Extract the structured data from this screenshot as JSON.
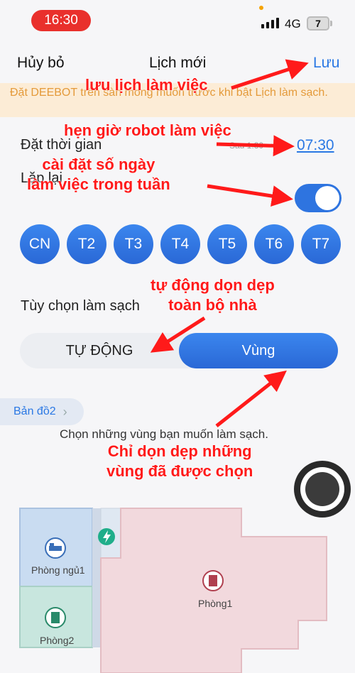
{
  "status_bar": {
    "time": "16:30",
    "network": "4G",
    "battery": "7"
  },
  "header": {
    "cancel": "Hủy bỏ",
    "title": "Lịch mới",
    "save": "Lưu"
  },
  "warning": "Đặt DEEBOT trên sàn mong muốn trước khi bật Lịch làm sạch.",
  "schedule": {
    "set_time_label": "Đặt thời gian",
    "time_secondary": "Sau 1:30",
    "time_value": "07:30",
    "repeat_label": "Lặp lại",
    "repeat_enabled": true
  },
  "days": [
    "CN",
    "T2",
    "T3",
    "T4",
    "T5",
    "T6",
    "T7"
  ],
  "cleaning": {
    "options_label": "Tùy chọn làm sạch",
    "mode_auto": "TỰ ĐỘNG",
    "mode_zone": "Vùng",
    "selected_mode": "Vùng"
  },
  "map": {
    "tab_label": "Bản đồ2",
    "instruction": "Chọn những vùng bạn muốn làm sạch.",
    "rooms": [
      "Phòng ngủ1",
      "Phòng1",
      "Phòng2"
    ]
  },
  "annotations": {
    "save_note": "lưu lịch làm việc",
    "time_note": "hẹn giờ robot làm việc",
    "days_note": "cài đặt số ngày\nlàm việc trong tuần",
    "auto_note": "tự động dọn dẹp\ntoàn bộ nhà",
    "zone_note": "Chỉ dọn dẹp những\nvùng đã được chọn"
  },
  "colors": {
    "accent": "#2a78e4",
    "status_red": "#e9302c",
    "warning_bg": "#fcecd6",
    "warning_text": "#e49a3a",
    "annotation_red": "#ff1a1a"
  }
}
